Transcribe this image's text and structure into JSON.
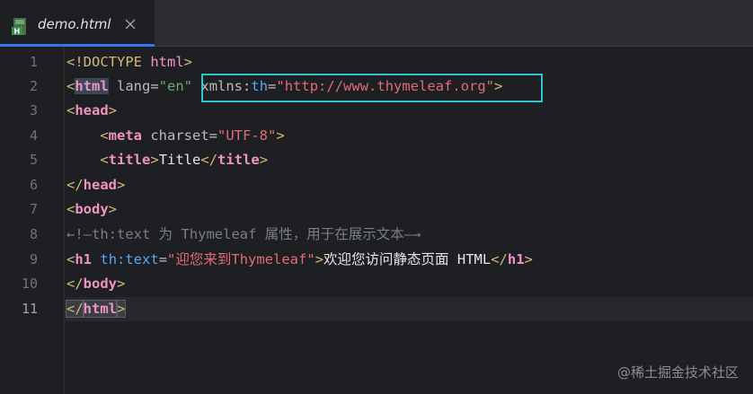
{
  "tab": {
    "label": "demo.html",
    "icon": "html-file-icon",
    "close_icon": "close-icon",
    "active": true
  },
  "gutter": {
    "line_numbers": [
      "1",
      "2",
      "3",
      "4",
      "5",
      "6",
      "7",
      "8",
      "9",
      "10",
      "11"
    ],
    "current_line": "11"
  },
  "code": {
    "line1": {
      "p1": "<!DOCTYPE ",
      "p2": "html",
      "p3": ">"
    },
    "line2": {
      "lt": "<",
      "tag": "html",
      "a1": " lang",
      "eq1": "=",
      "v1": "\"en\"",
      "sp": " ",
      "ns": "xmlns",
      "colon": ":",
      "th": "th",
      "eq2": "=",
      "v2": "\"http://www.thymeleaf.org\"",
      "gt": ">"
    },
    "line3": {
      "lt": "<",
      "tag": "head",
      "gt": ">"
    },
    "line4": {
      "indent": "    ",
      "lt": "<",
      "tag": "meta",
      "a1": " charset",
      "eq": "=",
      "v": "\"UTF-8\"",
      "gt": ">"
    },
    "line5": {
      "indent": "    ",
      "lt": "<",
      "tag": "title",
      "gt": ">",
      "text": "Title",
      "lt2": "</",
      "tag2": "title",
      "gt2": ">"
    },
    "line6": {
      "lt": "</",
      "tag": "head",
      "gt": ">"
    },
    "line7": {
      "lt": "<",
      "tag": "body",
      "gt": ">"
    },
    "line8": {
      "text": "←!—th:text 为 Thymeleaf 属性，用于在展示文本—→"
    },
    "line9": {
      "lt": "<",
      "tag": "h1",
      "sp": " ",
      "attr": "th:text",
      "eq": "=",
      "v": "\"迎您来到Thymeleaf\"",
      "gt": ">",
      "text": "欢迎您访问静态页面 HTML",
      "lt2": "</",
      "tag2": "h1",
      "gt2": ">"
    },
    "line10": {
      "lt": "</",
      "tag": "body",
      "gt": ">"
    },
    "line11": {
      "lt": "</",
      "tag": "html",
      "gt": ">"
    }
  },
  "watermark": "@稀土掘金技术社区",
  "colors": {
    "background": "#1e1f22",
    "tag_name": "#ed94c0",
    "bracket": "#d5b778",
    "string": "#6aab73",
    "highlight_box": "#33c3cf",
    "tab_underline": "#3574f0"
  }
}
